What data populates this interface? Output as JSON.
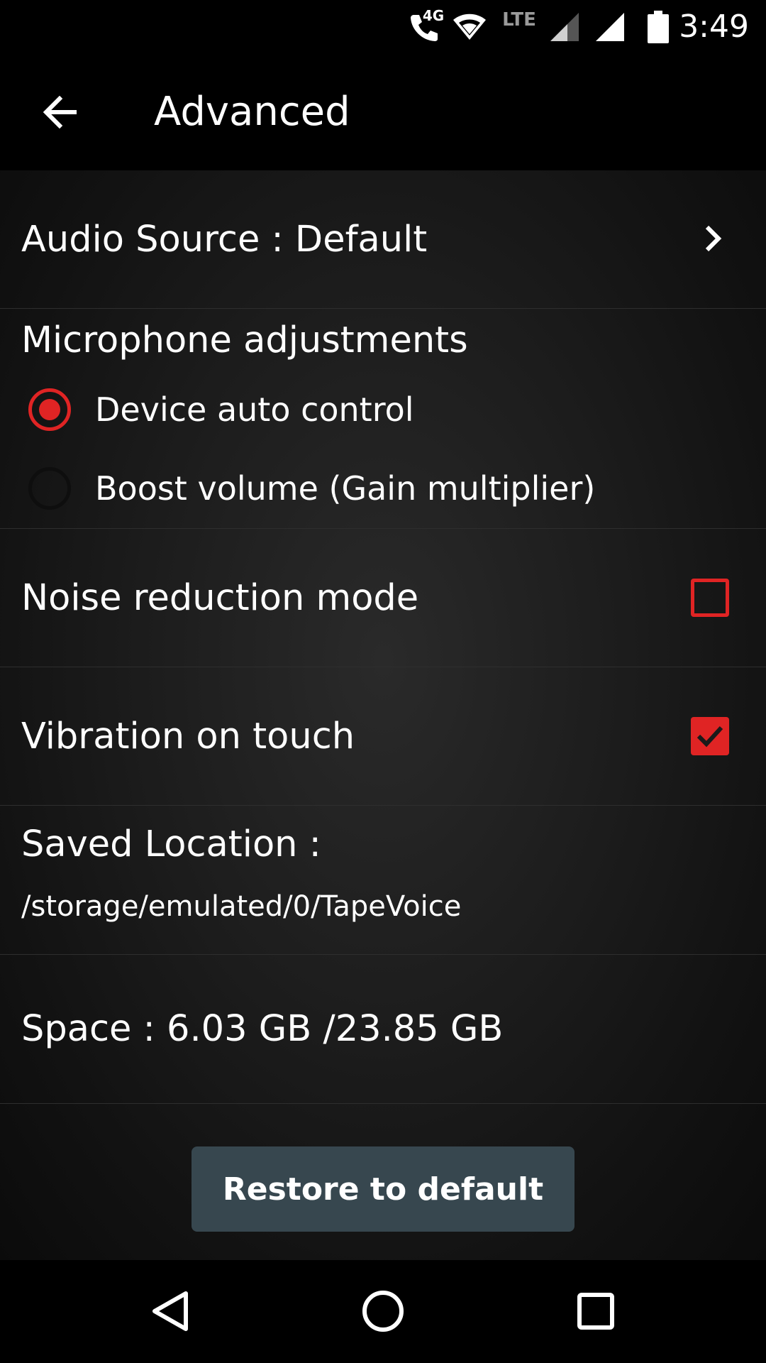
{
  "status_bar": {
    "time": "3:49",
    "network_label": "LTE",
    "call_icon_badge": "4G",
    "icons": [
      "wifi-calling-icon",
      "wifi-icon",
      "signal-icon",
      "signal-full-icon",
      "battery-icon"
    ]
  },
  "app_bar": {
    "title": "Advanced",
    "back_icon": "arrow-left-icon"
  },
  "settings": {
    "audio_source": {
      "label": "Audio Source : Default",
      "icon": "chevron-right-icon"
    },
    "microphone": {
      "heading": "Microphone adjustments",
      "options": [
        {
          "label": "Device auto control",
          "selected": true
        },
        {
          "label": "Boost volume (Gain multiplier)",
          "selected": false
        }
      ]
    },
    "noise_reduction": {
      "label": "Noise reduction mode",
      "checked": false
    },
    "vibration": {
      "label": "Vibration on touch",
      "checked": true
    },
    "saved_location": {
      "label": "Saved Location :",
      "path": "/storage/emulated/0/TapeVoice"
    },
    "space": {
      "label": "Space : 6.03 GB /23.85 GB"
    }
  },
  "restore_button": {
    "label": "Restore to default"
  },
  "nav_bar": {
    "icons": [
      "back-triangle-icon",
      "home-circle-icon",
      "recents-square-icon"
    ]
  },
  "colors": {
    "accent": "#e02424",
    "button_bg": "#37474f",
    "background": "#000000"
  }
}
